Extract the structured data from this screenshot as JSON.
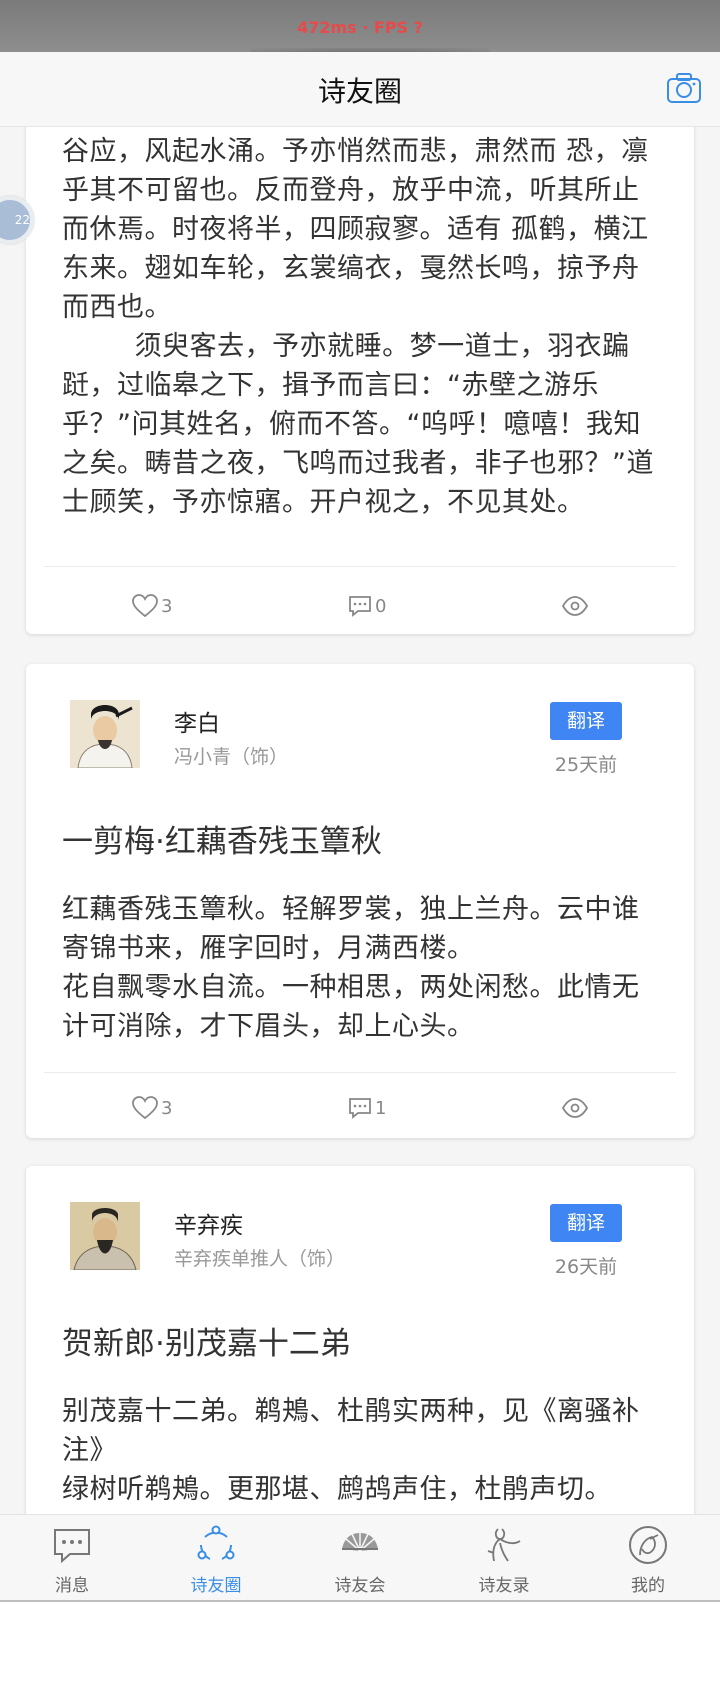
{
  "status": {
    "fps_text": "472ms · FPS ?"
  },
  "header": {
    "title": "诗友圈"
  },
  "float_ball": {
    "text": "22"
  },
  "cards": [
    {
      "text": "谷应，风起水涌。予亦悄然而悲，肃然而 恐，凛乎其不可留也。反而登舟，放乎中流，听其所止而休焉。时夜将半，四顾寂寥。适有 孤鹤，横江东来。翅如车轮，玄裳缟衣，戛然长鸣，掠予舟而西也。\n        须臾客去，予亦就睡。梦一道士，羽衣蹁跹，过临皋之下，揖予而言曰：“赤壁之游乐乎？”问其姓名，俯而不答。“呜呼！噫嘻！我知之矣。畴昔之夜，飞鸣而过我者，非子也邪？”道士顾笑，予亦惊寤。开户视之，不见其处。",
      "likes": "3",
      "comments": "0"
    },
    {
      "author": "李白",
      "actor": "冯小青（饰）",
      "translate_label": "翻译",
      "time": "25天前",
      "title": "一剪梅·红藕香残玉簟秋",
      "text": "红藕香残玉簟秋。轻解罗裳，独上兰舟。云中谁寄锦书来，雁字回时，月满西楼。\n花自飘零水自流。一种相思，两处闲愁。此情无计可消除，才下眉头，却上心头。",
      "likes": "3",
      "comments": "1"
    },
    {
      "author": "辛弃疾",
      "actor": "辛弃疾单推人（饰）",
      "translate_label": "翻译",
      "time": "26天前",
      "title": "贺新郎·别茂嘉十二弟",
      "text": "别茂嘉十二弟。鹈鴂、杜鹃实两种，见《离骚补注》\n绿树听鹈鴂。更那堪、鹧鸪声住，杜鹃声切。"
    }
  ],
  "tabs": [
    {
      "label": "消息",
      "icon": "message-icon"
    },
    {
      "label": "诗友圈",
      "icon": "circle-icon",
      "active": true
    },
    {
      "label": "诗友会",
      "icon": "fan-icon"
    },
    {
      "label": "诗友录",
      "icon": "poet-icon"
    },
    {
      "label": "我的",
      "icon": "profile-icon"
    }
  ],
  "colors": {
    "accent": "#3a8ee6",
    "translate_button": "#3f85f3"
  }
}
